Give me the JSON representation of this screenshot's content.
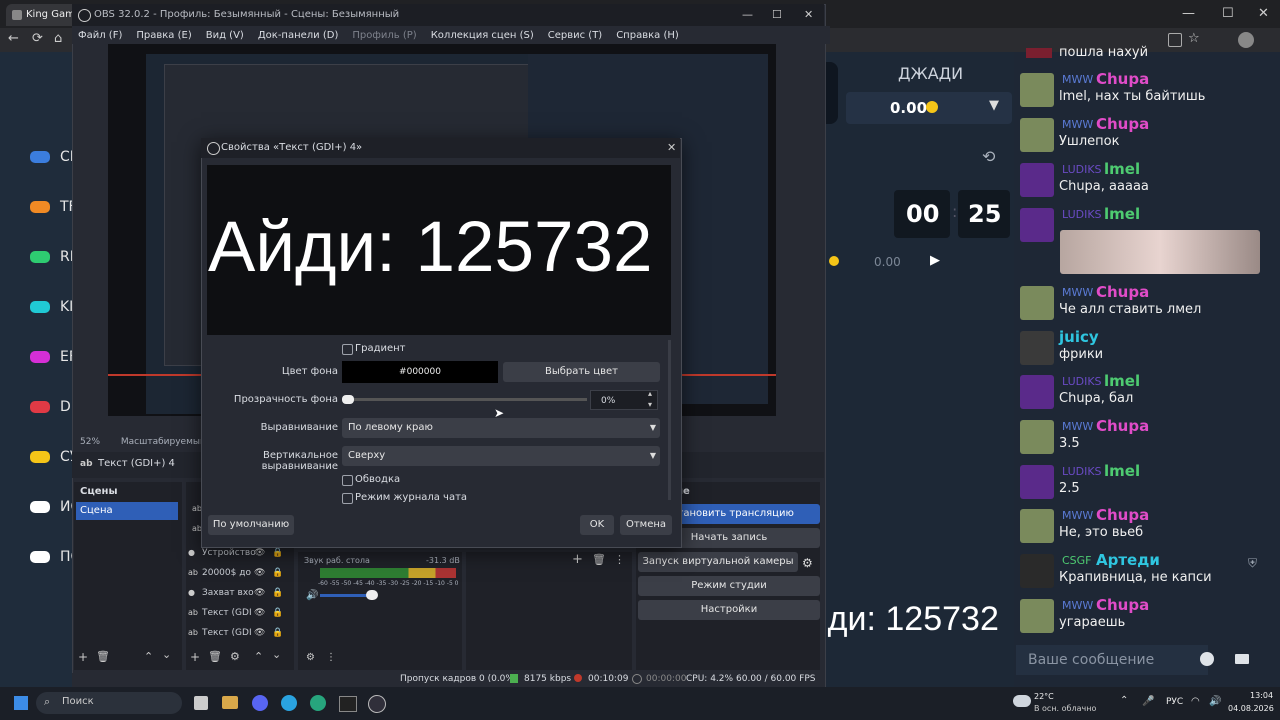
{
  "browser": {
    "tab_title": "King Game |",
    "win_min": "—",
    "win_max": "☐",
    "win_close": "✕",
    "back": "←",
    "reload": "⟳",
    "home": "⌂"
  },
  "site": {
    "nav": [
      {
        "label": "CL",
        "color": "#3b7ddd"
      },
      {
        "label": "TF",
        "color": "#f08a24"
      },
      {
        "label": "RI",
        "color": "#2ecc71"
      },
      {
        "label": "KI",
        "color": "#20c9d4"
      },
      {
        "label": "EF",
        "color": "#d62fd6"
      },
      {
        "label": "DI",
        "color": "#e03a45"
      },
      {
        "label": "СУ",
        "color": "#f5c518"
      },
      {
        "label": "ИС",
        "color": "#ffffff"
      },
      {
        "label": "ПС",
        "color": "#ffffff"
      }
    ],
    "jackpot_label": "ДЖАДИ",
    "jackpot_value": "0.00",
    "timer_min": "00",
    "timer_sec": "25",
    "timer_sep": ":",
    "bet_value": "0.00"
  },
  "chat": {
    "top_text": "пошла нахуй",
    "messages": [
      {
        "badge": "MWW",
        "name": "Chupa",
        "name_color": "#e04cc8",
        "badge_color": "#5b7bd5",
        "text": "lmel, нах ты байтишь",
        "avatar_color": "#7a8a5c"
      },
      {
        "badge": "MWW",
        "name": "Chupa",
        "name_color": "#e04cc8",
        "badge_color": "#5b7bd5",
        "text": "Ушлепок",
        "avatar_color": "#7a8a5c"
      },
      {
        "badge": "LUDIKS",
        "name": "lmel",
        "name_color": "#4ecb71",
        "badge_color": "#6a4bc4",
        "text": "Chupa, ааааа",
        "avatar_color": "#5a2a8a"
      },
      {
        "badge": "LUDIKS",
        "name": "lmel",
        "name_color": "#4ecb71",
        "badge_color": "#6a4bc4",
        "text": "",
        "avatar_color": "#5a2a8a"
      },
      {
        "badge": "MWW",
        "name": "Chupa",
        "name_color": "#e04cc8",
        "badge_color": "#5b7bd5",
        "text": "Че алл ставить лмел",
        "avatar_color": "#7a8a5c"
      },
      {
        "badge": "",
        "name": "juicy",
        "name_color": "#2fc6e0",
        "badge_color": "#000",
        "text": "фрики",
        "avatar_color": "#3a3a3a"
      },
      {
        "badge": "LUDIKS",
        "name": "lmel",
        "name_color": "#4ecb71",
        "badge_color": "#6a4bc4",
        "text": "Chupa, бал",
        "avatar_color": "#5a2a8a"
      },
      {
        "badge": "MWW",
        "name": "Chupa",
        "name_color": "#e04cc8",
        "badge_color": "#5b7bd5",
        "text": "3.5",
        "avatar_color": "#7a8a5c"
      },
      {
        "badge": "LUDIKS",
        "name": "lmel",
        "name_color": "#4ecb71",
        "badge_color": "#6a4bc4",
        "text": "2.5",
        "avatar_color": "#5a2a8a"
      },
      {
        "badge": "MWW",
        "name": "Chupa",
        "name_color": "#e04cc8",
        "badge_color": "#5b7bd5",
        "text": "Не, это вьеб",
        "avatar_color": "#7a8a5c"
      },
      {
        "badge": "CSGF",
        "name": "Артеди",
        "name_color": "#2fc6e0",
        "badge_color": "#4ecb71",
        "text": "Крапивница, не капси",
        "avatar_color": "#2a2a2a"
      },
      {
        "badge": "MWW",
        "name": "Chupa",
        "name_color": "#e04cc8",
        "badge_color": "#5b7bd5",
        "text": "угараешь",
        "avatar_color": "#7a8a5c"
      }
    ],
    "input_placeholder": "Ваше сообщение"
  },
  "overlay_id": "Айди: 125732",
  "obs": {
    "title": "OBS 32.0.2 - Профиль: Безымянный - Сцены: Безымянный",
    "menu": [
      "Файл (F)",
      "Правка (E)",
      "Вид (V)",
      "Док-панели (D)",
      "Профиль (P)",
      "Коллекция сцен (S)",
      "Сервис (T)",
      "Справка (H)"
    ],
    "zoom": "52%",
    "scaling": "Масштабируемый",
    "source_title": "Текст (GDI+) 4",
    "scenes_title": "Сцены",
    "scene_item": "Сцена",
    "sources": [
      "Устройство",
      "20000$ до",
      "Захват вхо",
      "Текст (GDI",
      "Текст (GDI"
    ],
    "mixer_source": "Звук раб. стола",
    "mixer_db": "-31.3 dB",
    "mixer_scale": "-60 -55 -50 -45 -40 -35 -30 -25 -20 -15 -10 -5 0",
    "controls_title": "ие",
    "controls": [
      "Остановить трансляцию",
      "Начать запись",
      "Запуск виртуальной камеры",
      "Режим студии",
      "Настройки"
    ],
    "status": {
      "frames": "Пропуск кадров 0 (0.0%)",
      "bitrate": "8175 kbps",
      "stream_time": "00:10:09",
      "rec_time": "00:00:00",
      "cpu": "CPU: 4.2%",
      "fps": "60.00 / 60.00 FPS"
    }
  },
  "dialog": {
    "title": "Свойства «Текст (GDI+) 4»",
    "preview_text": "Айди: 125732",
    "gradient_label": "Градиент",
    "bg_color_label": "Цвет фона",
    "bg_color_value": "#000000",
    "pick_color_btn": "Выбрать цвет",
    "bg_opacity_label": "Прозрачность фона",
    "bg_opacity_value": "0%",
    "bg_opacity": 0,
    "align_label": "Выравнивание",
    "align_value": "По левому краю",
    "valign_label": "Вертикальное выравнивание",
    "valign_value": "Сверху",
    "outline_label": "Обводка",
    "chatlog_label": "Режим журнала чата",
    "defaults_btn": "По умолчанию",
    "ok_btn": "OK",
    "cancel_btn": "Отмена"
  },
  "taskbar": {
    "search_placeholder": "Поиск",
    "weather_temp": "22°C",
    "weather_desc": "В осн. облачно",
    "lang": "РУС",
    "time": "13:04",
    "date": "04.08.2026"
  }
}
